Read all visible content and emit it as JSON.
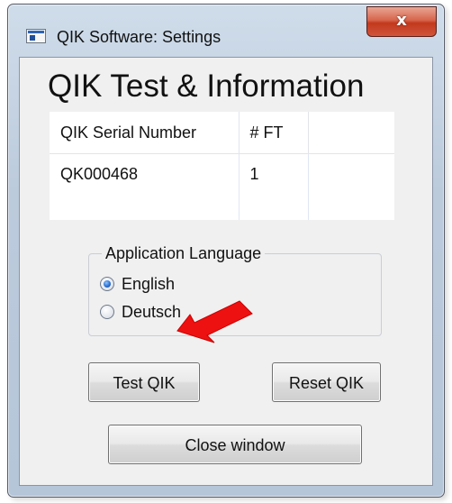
{
  "window": {
    "title": "QIK Software: Settings",
    "close_label": "x",
    "icon": "application-window-icon"
  },
  "content": {
    "heading": "QIK Test & Information",
    "table": {
      "columns": [
        "QIK Serial Number",
        "# FT",
        ""
      ],
      "rows": [
        [
          "QK000468",
          "1",
          ""
        ]
      ]
    },
    "language_group": {
      "legend": "Application Language",
      "options": [
        {
          "label": "English",
          "selected": true
        },
        {
          "label": "Deutsch",
          "selected": false
        }
      ]
    },
    "buttons": {
      "test_label": "Test QIK",
      "reset_label": "Reset QIK",
      "close_label": "Close window"
    }
  },
  "annotation": {
    "arrow_color": "#ee1111",
    "points_to": "test-qik-button"
  },
  "colors": {
    "window_frame": "#b5c6d9",
    "close_button": "#c2391d",
    "client_background": "#f0f0f0",
    "radio_selected": "#2a6fcf"
  }
}
